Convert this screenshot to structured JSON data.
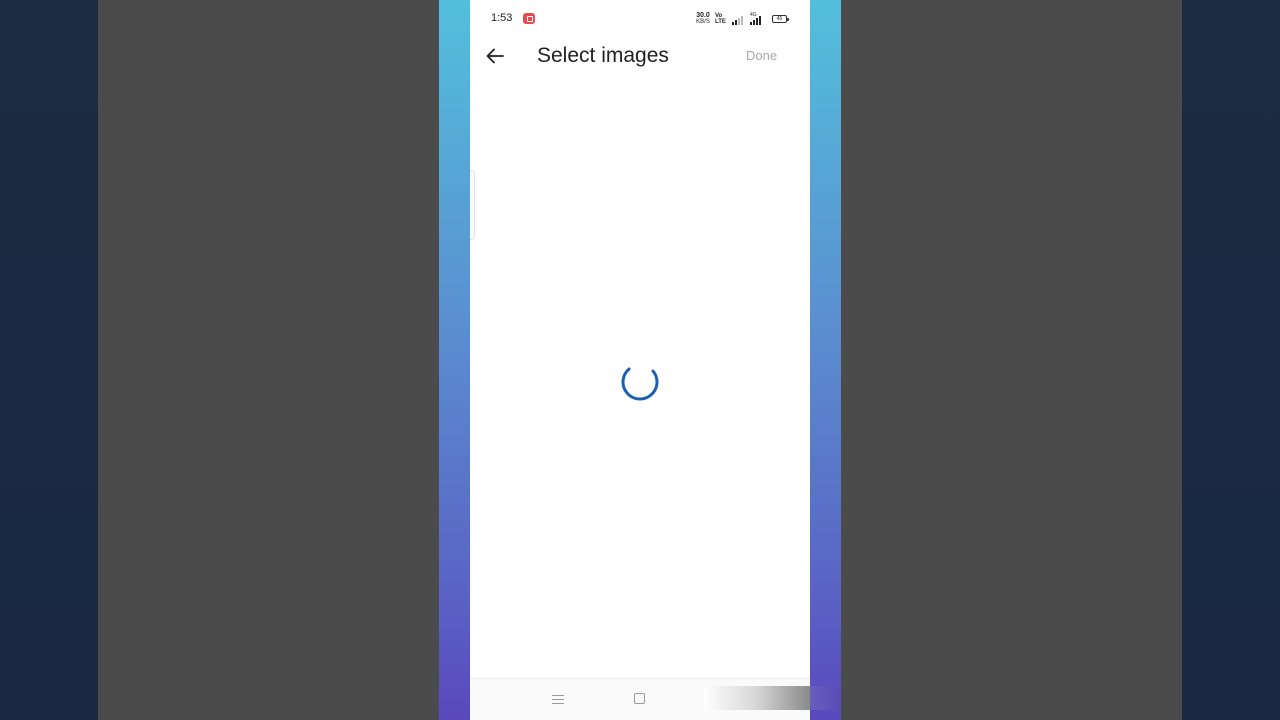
{
  "status_bar": {
    "time": "1:53",
    "net_speed_value": "30.0",
    "net_speed_unit": "KB/S",
    "volte_top": "Vo",
    "volte_bottom": "LTE",
    "network_type": "4G",
    "battery_level": "45",
    "icons": [
      "screen-record-icon",
      "signal-icon",
      "battery-icon"
    ]
  },
  "app_bar": {
    "back_icon": "arrow-back-icon",
    "title": "Select images",
    "done_label": "Done"
  },
  "content": {
    "loading_indicator": "spinner-icon"
  },
  "nav_bar": {
    "icons": [
      "menu-icon",
      "home-icon"
    ]
  },
  "colors": {
    "frame_top": "#53bfdc",
    "frame_bottom": "#5a48bc",
    "spinner": "#1a5fb4",
    "done_disabled": "#a8a8a8",
    "record_badge": "#e8484f"
  }
}
